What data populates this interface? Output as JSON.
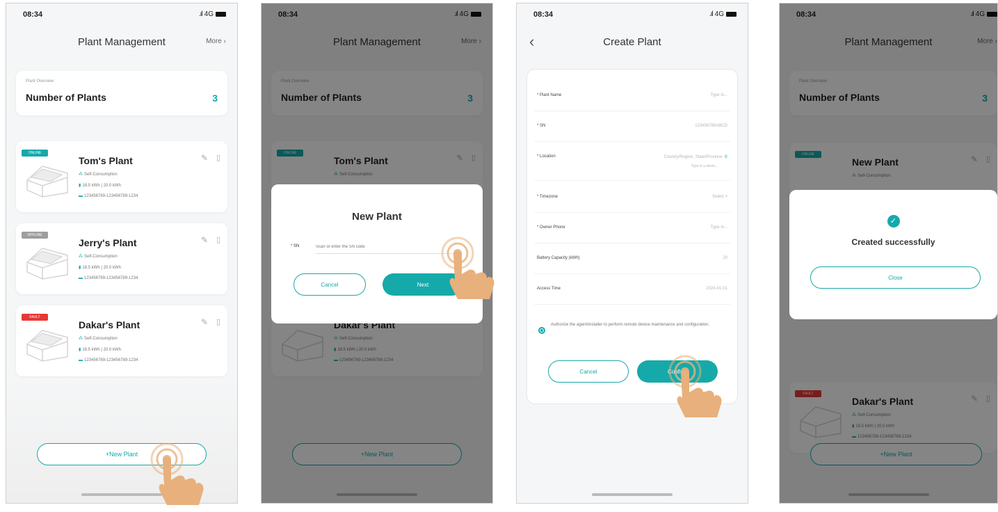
{
  "status": {
    "time": "08:34",
    "network": "4G"
  },
  "management": {
    "title": "Plant Management",
    "more": "More",
    "overview_label": "Plant Overview",
    "overview_title": "Number of Plants",
    "count": "3"
  },
  "plants": [
    {
      "name": "Tom's Plant",
      "tag": "ONLINE",
      "tag_color": "#16a9a9",
      "mode": "Self-Consumption",
      "capacity": "18.5 kWh",
      "total": "20.0 kWh",
      "sn": "123456789-123456789-1234"
    },
    {
      "name": "Jerry's Plant",
      "tag": "OFFLINE",
      "tag_color": "#9e9e9e",
      "mode": "Self-Consumption",
      "capacity": "18.5 kWh",
      "total": "20.0 kWh",
      "sn": "123456789-123456789-1234"
    },
    {
      "name": "Dakar's Plant",
      "tag": "FAULT",
      "tag_color": "#e53935",
      "mode": "Self-Consumption",
      "capacity": "18.5 kWh",
      "total": "20.0 kWh",
      "sn": "123456789-123456789-1234"
    }
  ],
  "created_plant_name": "New Plant",
  "new_plant_button": "+New Plant",
  "dialog": {
    "title": "New Plant",
    "sn_label": "* SN",
    "sn_placeholder": "Scan or enter the SN code",
    "cancel": "Cancel",
    "next": "Next"
  },
  "create": {
    "title": "Create Plant",
    "rows": [
      {
        "label": "* Plant Name",
        "value": "Type in..."
      },
      {
        "label": "* SN",
        "value": "123456789ABCD"
      },
      {
        "label": "* Location",
        "value": "Country/Region, State/Province",
        "hint": "Type in a street..."
      },
      {
        "label": "* Timezone",
        "value": "Select >"
      },
      {
        "label": "* Owner Phone",
        "value": "Type in..."
      },
      {
        "label": "Battery Capacity (kWh)",
        "value": "20"
      },
      {
        "label": "Access Time",
        "value": "2024-01-01"
      }
    ],
    "consent": "Authorize the agent/installer to perform remote device maintenance and configuration.",
    "cancel": "Cancel",
    "confirm": "Confirm"
  },
  "success": {
    "message": "Created successfully",
    "close": "Close"
  },
  "colors": {
    "accent": "#16a9a9",
    "fault": "#e53935",
    "offline": "#9e9e9e",
    "hand": "#e8b07c"
  },
  "icons": [
    "edit-icon",
    "trash-icon",
    "mode-icon",
    "battery-icon",
    "serial-icon",
    "check-icon",
    "location-pin-icon",
    "back-chevron-icon",
    "tap-hand-icon"
  ]
}
